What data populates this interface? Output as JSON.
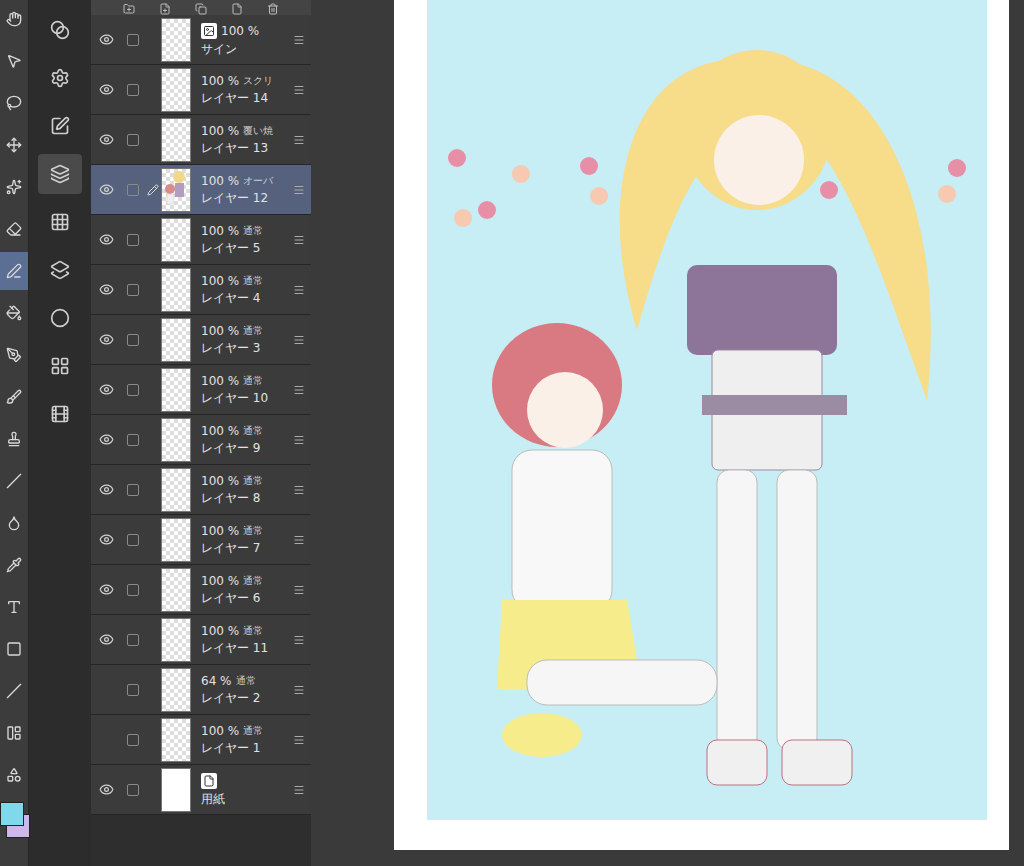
{
  "tools": [
    {
      "selected": false
    },
    {
      "selected": false
    },
    {
      "selected": false
    },
    {
      "selected": false
    },
    {
      "selected": false
    },
    {
      "selected": false
    },
    {
      "selected": true
    },
    {
      "selected": false
    },
    {
      "selected": false
    },
    {
      "selected": false
    },
    {
      "selected": false
    },
    {
      "selected": false
    },
    {
      "selected": false
    },
    {
      "selected": false
    },
    {
      "selected": false
    },
    {
      "selected": false
    },
    {
      "selected": false
    },
    {
      "selected": false
    },
    {
      "selected": false
    }
  ],
  "color_swatches": [
    {
      "color": "#7fd8ec"
    },
    {
      "color": "#cdb9e8"
    }
  ],
  "panels": [
    {
      "selected": false
    },
    {
      "selected": false
    },
    {
      "selected": false
    },
    {
      "selected": true
    },
    {
      "selected": false
    },
    {
      "selected": false
    },
    {
      "selected": false
    },
    {
      "selected": false
    },
    {
      "selected": false
    }
  ],
  "layers": [
    {
      "name": "サイン",
      "opacity": "100 %",
      "mode": "",
      "kind": "image",
      "visible": true,
      "selected": false,
      "editing": false
    },
    {
      "name": "レイヤー 14",
      "opacity": "100 %",
      "mode": "スクリ",
      "kind": "raster",
      "visible": true,
      "selected": false,
      "editing": false
    },
    {
      "name": "レイヤー 13",
      "opacity": "100 %",
      "mode": "覆い焼",
      "kind": "raster",
      "visible": true,
      "selected": false,
      "editing": false
    },
    {
      "name": "レイヤー 12",
      "opacity": "100 %",
      "mode": "オーバ",
      "kind": "art",
      "visible": true,
      "selected": true,
      "editing": true
    },
    {
      "name": "レイヤー 5",
      "opacity": "100 %",
      "mode": "通常",
      "kind": "raster",
      "visible": true,
      "selected": false,
      "editing": false
    },
    {
      "name": "レイヤー 4",
      "opacity": "100 %",
      "mode": "通常",
      "kind": "raster",
      "visible": true,
      "selected": false,
      "editing": false
    },
    {
      "name": "レイヤー 3",
      "opacity": "100 %",
      "mode": "通常",
      "kind": "raster",
      "visible": true,
      "selected": false,
      "editing": false
    },
    {
      "name": "レイヤー 10",
      "opacity": "100 %",
      "mode": "通常",
      "kind": "raster",
      "visible": true,
      "selected": false,
      "editing": false
    },
    {
      "name": "レイヤー 9",
      "opacity": "100 %",
      "mode": "通常",
      "kind": "raster",
      "visible": true,
      "selected": false,
      "editing": false
    },
    {
      "name": "レイヤー 8",
      "opacity": "100 %",
      "mode": "通常",
      "kind": "raster",
      "visible": true,
      "selected": false,
      "editing": false
    },
    {
      "name": "レイヤー 7",
      "opacity": "100 %",
      "mode": "通常",
      "kind": "raster",
      "visible": true,
      "selected": false,
      "editing": false
    },
    {
      "name": "レイヤー 6",
      "opacity": "100 %",
      "mode": "通常",
      "kind": "raster",
      "visible": true,
      "selected": false,
      "editing": false
    },
    {
      "name": "レイヤー 11",
      "opacity": "100 %",
      "mode": "通常",
      "kind": "raster",
      "visible": true,
      "selected": false,
      "editing": false
    },
    {
      "name": "レイヤー 2",
      "opacity": "64 %",
      "mode": "通常",
      "kind": "raster",
      "visible": false,
      "selected": false,
      "editing": false
    },
    {
      "name": "レイヤー 1",
      "opacity": "100 %",
      "mode": "通常",
      "kind": "raster",
      "visible": false,
      "selected": false,
      "editing": false
    },
    {
      "name": "用紙",
      "opacity": "",
      "mode": "",
      "kind": "paper",
      "visible": true,
      "selected": false,
      "editing": false
    }
  ]
}
